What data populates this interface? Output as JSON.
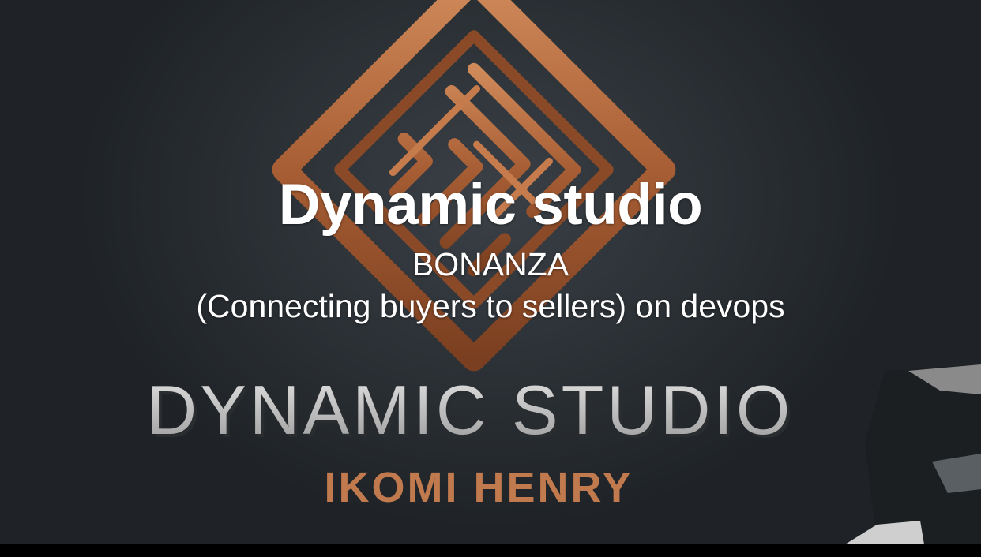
{
  "hero": {
    "title": "Dynamic studio",
    "subtitle": "BONANZA",
    "description": "(Connecting buyers to sellers) on devops"
  },
  "background_logo": {
    "wordmark": "DYNAMIC STUDIO",
    "tagline": "IKOMI HENRY",
    "icon": "diamond-maze-logo-icon"
  },
  "colors": {
    "background": "#2b3035",
    "logo_copper": "#b86a3e",
    "wordmark_silver": "#c9c9c9",
    "tagline_copper": "#c07a4e",
    "overlay_text": "#ffffff"
  }
}
